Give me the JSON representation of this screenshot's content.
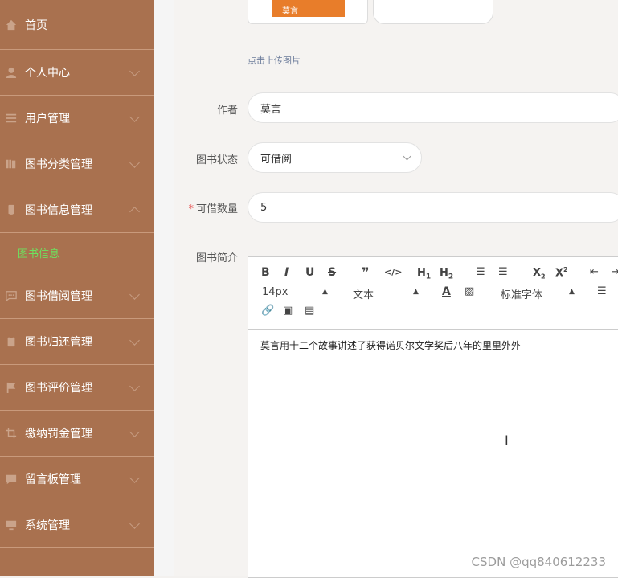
{
  "sidebar": {
    "items": [
      {
        "label": "首页",
        "icon": "home-icon"
      },
      {
        "label": "个人中心",
        "icon": "user-icon"
      },
      {
        "label": "用户管理",
        "icon": "list-icon"
      },
      {
        "label": "图书分类管理",
        "icon": "books-icon"
      },
      {
        "label": "图书信息管理",
        "icon": "phone-icon"
      },
      {
        "label": "图书信息",
        "icon": ""
      },
      {
        "label": "图书借阅管理",
        "icon": "chat-icon"
      },
      {
        "label": "图书归还管理",
        "icon": "clipboard-icon"
      },
      {
        "label": "图书评价管理",
        "icon": "flag-icon"
      },
      {
        "label": "缴纳罚金管理",
        "icon": "crop-icon"
      },
      {
        "label": "留言板管理",
        "icon": "message-icon"
      },
      {
        "label": "系统管理",
        "icon": "monitor-icon"
      }
    ]
  },
  "form": {
    "thumb_text": "莫言",
    "upload_hint": "点击上传图片",
    "author_label": "作者",
    "author_value": "莫言",
    "status_label": "图书状态",
    "status_value": "可借阅",
    "qty_label": "可借数量",
    "qty_required": "*",
    "qty_value": "5",
    "intro_label": "图书简介"
  },
  "editor": {
    "font_size": "14px",
    "paragraph": "文本",
    "font_family": "标准字体",
    "content": "莫言用十二个故事讲述了获得诺贝尔文学奖后八年的里里外外"
  },
  "watermark": "CSDN @qq840612233"
}
